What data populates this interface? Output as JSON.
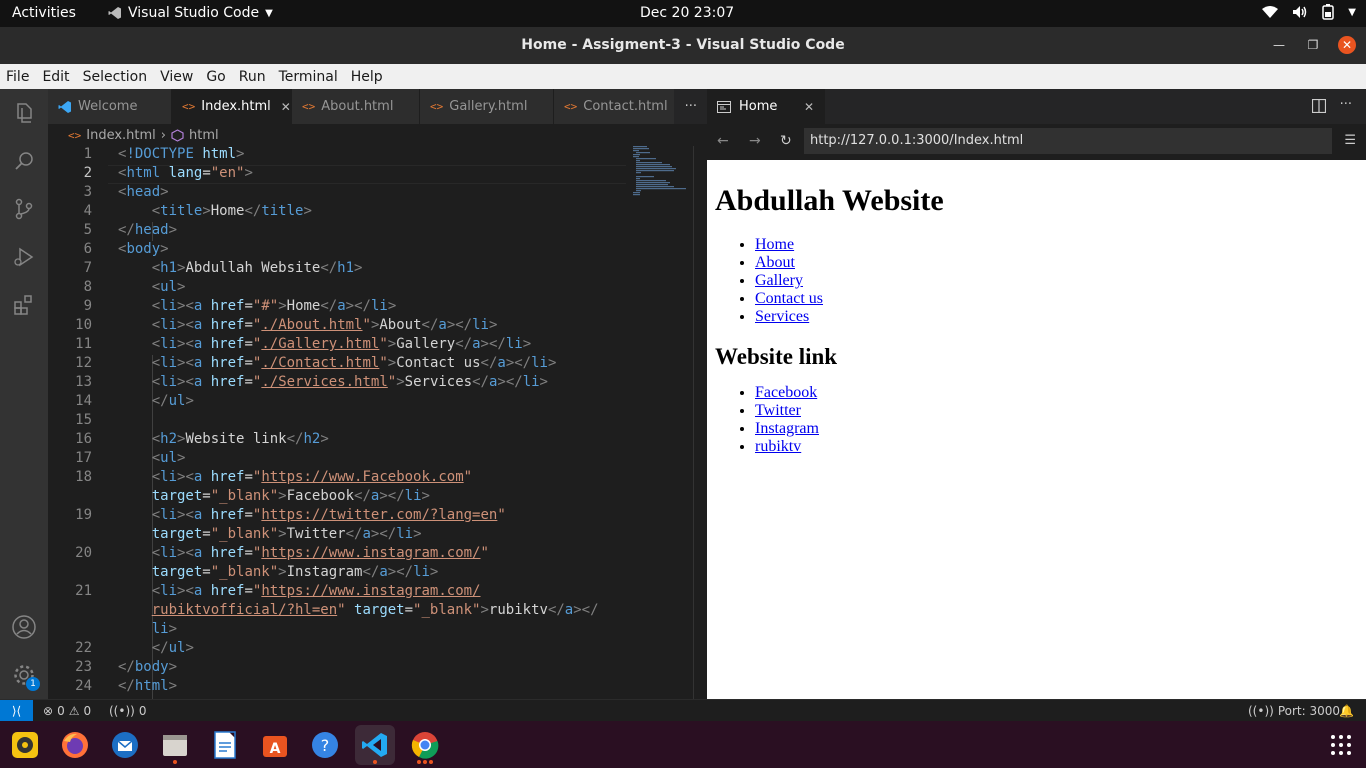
{
  "topbar": {
    "activities": "Activities",
    "app_name": "Visual Studio Code",
    "clock": "Dec 20  23:07"
  },
  "window": {
    "title": "Home - Assigment-3 - Visual Studio Code"
  },
  "menu": [
    "File",
    "Edit",
    "Selection",
    "View",
    "Go",
    "Run",
    "Terminal",
    "Help"
  ],
  "editor_tabs": [
    {
      "label": "Welcome",
      "icon": "vscode-logo-icon",
      "active": false
    },
    {
      "label": "Index.html",
      "icon": "html-file-icon",
      "active": true
    },
    {
      "label": "About.html",
      "icon": "html-file-icon",
      "active": false
    },
    {
      "label": "Gallery.html",
      "icon": "html-file-icon",
      "active": false
    },
    {
      "label": "Contact.html",
      "icon": "html-file-icon",
      "active": false
    }
  ],
  "breadcrumb": {
    "file": "Index.html",
    "symbol": "html"
  },
  "code": {
    "current_line": 2,
    "lines": [
      {
        "n": "1",
        "html": "<span class=\"tg\">&lt;</span><span class=\"tn\">!DOCTYPE</span> <span class=\"at\">html</span><span class=\"tg\">&gt;</span>"
      },
      {
        "n": "2",
        "html": "<span class=\"tg\">&lt;</span><span class=\"tn\">html</span> <span class=\"at\">lang</span>=<span class=\"st\">\"en\"</span><span class=\"tg\">&gt;</span>"
      },
      {
        "n": "3",
        "html": "<span class=\"tg\">&lt;</span><span class=\"tn\">head</span><span class=\"tg\">&gt;</span>"
      },
      {
        "n": "4",
        "html": "    <span class=\"tg\">&lt;</span><span class=\"tn\">title</span><span class=\"tg\">&gt;</span>Home<span class=\"tg\">&lt;/</span><span class=\"tn\">title</span><span class=\"tg\">&gt;</span>"
      },
      {
        "n": "5",
        "html": "<span class=\"tg\">&lt;/</span><span class=\"tn\">head</span><span class=\"tg\">&gt;</span>"
      },
      {
        "n": "6",
        "html": "<span class=\"tg\">&lt;</span><span class=\"tn\">body</span><span class=\"tg\">&gt;</span>"
      },
      {
        "n": "7",
        "html": "    <span class=\"tg\">&lt;</span><span class=\"tn\">h1</span><span class=\"tg\">&gt;</span>Abdullah Website<span class=\"tg\">&lt;/</span><span class=\"tn\">h1</span><span class=\"tg\">&gt;</span>"
      },
      {
        "n": "8",
        "html": "    <span class=\"tg\">&lt;</span><span class=\"tn\">ul</span><span class=\"tg\">&gt;</span>"
      },
      {
        "n": "9",
        "html": "    <span class=\"tg\">&lt;</span><span class=\"tn\">li</span><span class=\"tg\">&gt;&lt;</span><span class=\"tn\">a</span> <span class=\"at\">href</span>=<span class=\"st\">\"#\"</span><span class=\"tg\">&gt;</span>Home<span class=\"tg\">&lt;/</span><span class=\"tn\">a</span><span class=\"tg\">&gt;&lt;/</span><span class=\"tn\">li</span><span class=\"tg\">&gt;</span>"
      },
      {
        "n": "10",
        "html": "    <span class=\"tg\">&lt;</span><span class=\"tn\">li</span><span class=\"tg\">&gt;&lt;</span><span class=\"tn\">a</span> <span class=\"at\">href</span>=<span class=\"st\">\"</span><span class=\"lk\">./About.html</span><span class=\"st\">\"</span><span class=\"tg\">&gt;</span>About<span class=\"tg\">&lt;/</span><span class=\"tn\">a</span><span class=\"tg\">&gt;&lt;/</span><span class=\"tn\">li</span><span class=\"tg\">&gt;</span>"
      },
      {
        "n": "11",
        "html": "    <span class=\"tg\">&lt;</span><span class=\"tn\">li</span><span class=\"tg\">&gt;&lt;</span><span class=\"tn\">a</span> <span class=\"at\">href</span>=<span class=\"st\">\"</span><span class=\"lk\">./Gallery.html</span><span class=\"st\">\"</span><span class=\"tg\">&gt;</span>Gallery<span class=\"tg\">&lt;/</span><span class=\"tn\">a</span><span class=\"tg\">&gt;&lt;/</span><span class=\"tn\">li</span><span class=\"tg\">&gt;</span>"
      },
      {
        "n": "12",
        "html": "    <span class=\"tg\">&lt;</span><span class=\"tn\">li</span><span class=\"tg\">&gt;&lt;</span><span class=\"tn\">a</span> <span class=\"at\">href</span>=<span class=\"st\">\"</span><span class=\"lk\">./Contact.html</span><span class=\"st\">\"</span><span class=\"tg\">&gt;</span>Contact us<span class=\"tg\">&lt;/</span><span class=\"tn\">a</span><span class=\"tg\">&gt;&lt;/</span><span class=\"tn\">li</span><span class=\"tg\">&gt;</span>"
      },
      {
        "n": "13",
        "html": "    <span class=\"tg\">&lt;</span><span class=\"tn\">li</span><span class=\"tg\">&gt;&lt;</span><span class=\"tn\">a</span> <span class=\"at\">href</span>=<span class=\"st\">\"</span><span class=\"lk\">./Services.html</span><span class=\"st\">\"</span><span class=\"tg\">&gt;</span>Services<span class=\"tg\">&lt;/</span><span class=\"tn\">a</span><span class=\"tg\">&gt;&lt;/</span><span class=\"tn\">li</span><span class=\"tg\">&gt;</span>"
      },
      {
        "n": "14",
        "html": "    <span class=\"tg\">&lt;/</span><span class=\"tn\">ul</span><span class=\"tg\">&gt;</span>"
      },
      {
        "n": "15",
        "html": ""
      },
      {
        "n": "16",
        "html": "    <span class=\"tg\">&lt;</span><span class=\"tn\">h2</span><span class=\"tg\">&gt;</span>Website link<span class=\"tg\">&lt;/</span><span class=\"tn\">h2</span><span class=\"tg\">&gt;</span>"
      },
      {
        "n": "17",
        "html": "    <span class=\"tg\">&lt;</span><span class=\"tn\">ul</span><span class=\"tg\">&gt;</span>"
      },
      {
        "n": "18",
        "html": "    <span class=\"tg\">&lt;</span><span class=\"tn\">li</span><span class=\"tg\">&gt;&lt;</span><span class=\"tn\">a</span> <span class=\"at\">href</span>=<span class=\"st\">\"</span><span class=\"lk\">https://www.Facebook.com</span><span class=\"st\">\"</span>"
      },
      {
        "n": "",
        "html": "    <span class=\"at\">target</span>=<span class=\"st\">\"_blank\"</span><span class=\"tg\">&gt;</span>Facebook<span class=\"tg\">&lt;/</span><span class=\"tn\">a</span><span class=\"tg\">&gt;&lt;/</span><span class=\"tn\">li</span><span class=\"tg\">&gt;</span>"
      },
      {
        "n": "19",
        "html": "    <span class=\"tg\">&lt;</span><span class=\"tn\">li</span><span class=\"tg\">&gt;&lt;</span><span class=\"tn\">a</span> <span class=\"at\">href</span>=<span class=\"st\">\"</span><span class=\"lk\">https://twitter.com/?lang=en</span><span class=\"st\">\"</span>"
      },
      {
        "n": "",
        "html": "    <span class=\"at\">target</span>=<span class=\"st\">\"_blank\"</span><span class=\"tg\">&gt;</span>Twitter<span class=\"tg\">&lt;/</span><span class=\"tn\">a</span><span class=\"tg\">&gt;&lt;/</span><span class=\"tn\">li</span><span class=\"tg\">&gt;</span>"
      },
      {
        "n": "20",
        "html": "    <span class=\"tg\">&lt;</span><span class=\"tn\">li</span><span class=\"tg\">&gt;&lt;</span><span class=\"tn\">a</span> <span class=\"at\">href</span>=<span class=\"st\">\"</span><span class=\"lk\">https://www.instagram.com/</span><span class=\"st\">\"</span>"
      },
      {
        "n": "",
        "html": "    <span class=\"at\">target</span>=<span class=\"st\">\"_blank\"</span><span class=\"tg\">&gt;</span>Instagram<span class=\"tg\">&lt;/</span><span class=\"tn\">a</span><span class=\"tg\">&gt;&lt;/</span><span class=\"tn\">li</span><span class=\"tg\">&gt;</span>"
      },
      {
        "n": "21",
        "html": "    <span class=\"tg\">&lt;</span><span class=\"tn\">li</span><span class=\"tg\">&gt;&lt;</span><span class=\"tn\">a</span> <span class=\"at\">href</span>=<span class=\"st\">\"</span><span class=\"lk\">https://www.instagram.com/</span>"
      },
      {
        "n": "",
        "html": "    <span class=\"lk\">rubiktvofficial/?hl=en</span><span class=\"st\">\"</span> <span class=\"at\">target</span>=<span class=\"st\">\"_blank\"</span><span class=\"tg\">&gt;</span>rubiktv<span class=\"tg\">&lt;/</span><span class=\"tn\">a</span><span class=\"tg\">&gt;&lt;/</span>"
      },
      {
        "n": "",
        "html": "    <span class=\"tn\">li</span><span class=\"tg\">&gt;</span>"
      },
      {
        "n": "22",
        "html": "    <span class=\"tg\">&lt;/</span><span class=\"tn\">ul</span><span class=\"tg\">&gt;</span>"
      },
      {
        "n": "23",
        "html": "<span class=\"tg\">&lt;/</span><span class=\"tn\">body</span><span class=\"tg\">&gt;</span>"
      },
      {
        "n": "24",
        "html": "<span class=\"tg\">&lt;/</span><span class=\"tn\">html</span><span class=\"tg\">&gt;</span>"
      }
    ]
  },
  "preview": {
    "tab_label": "Home",
    "url": "http://127.0.0.1:3000/Index.html",
    "h1": "Abdullah Website",
    "nav_links": [
      "Home",
      "About",
      "Gallery",
      "Contact us",
      "Services"
    ],
    "h2": "Website link",
    "external_links": [
      "Facebook",
      "Twitter",
      "Instagram",
      "rubiktv"
    ]
  },
  "statusbar": {
    "errors": "0",
    "warnings": "0",
    "ports": "0",
    "port_label": "Port: 3000"
  },
  "activity_badge": "1",
  "colors": {
    "accent": "#0078d4",
    "ubuntu_orange": "#e95420",
    "dock_bg": "#2a0f22"
  }
}
